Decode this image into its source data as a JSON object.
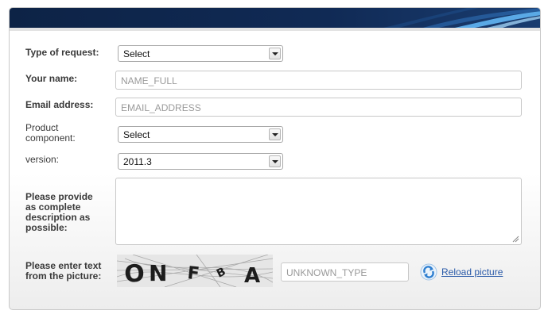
{
  "form": {
    "request_type": {
      "label": "Type of request:",
      "value": "Select"
    },
    "name": {
      "label": "Your name:",
      "placeholder": "NAME_FULL"
    },
    "email": {
      "label": "Email address:",
      "placeholder": "EMAIL_ADDRESS"
    },
    "component": {
      "label_line1": "Product",
      "label_line2": "component:",
      "value": "Select"
    },
    "version": {
      "label": "version:",
      "value": "2011.3"
    },
    "description": {
      "label_line1": "Please provide",
      "label_line2": "as complete",
      "label_line3": "description as",
      "label_line4": "possible:",
      "value": ""
    },
    "captcha": {
      "label_line1": "Please enter text",
      "label_line2": "from the picture:",
      "text": "ONFBA",
      "placeholder": "UNKNOWN_TYPE",
      "reload_label": "Reload picture"
    }
  },
  "icons": {
    "reload": "reload-icon",
    "dropdown": "chevron-down-icon",
    "resize": "resize-grip-icon"
  },
  "colors": {
    "header": "#0d2346",
    "accent": "#4a9fdc",
    "link": "#2a5aa8"
  }
}
